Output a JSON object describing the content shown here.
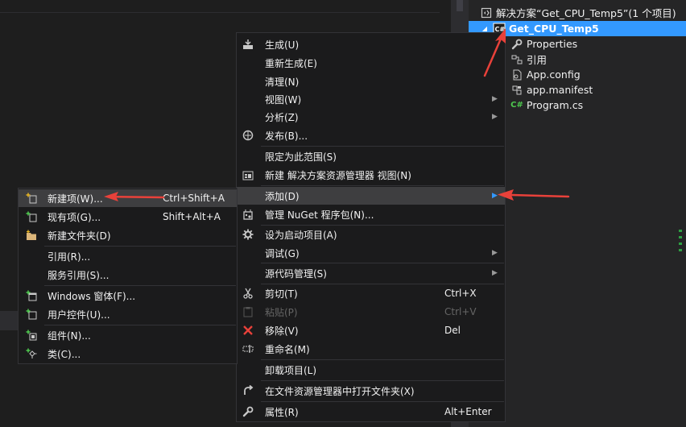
{
  "colors": {
    "menu_bg": "#1b1b1c",
    "menu_highlight": "#3e3e40",
    "selection": "#3399ff",
    "panel_bg": "#252526",
    "annotation_arrow": "#e8413a",
    "csharp_green": "#4ec94e"
  },
  "solution_explorer": {
    "solution": {
      "label": "解决方案“Get_CPU_Temp5”(1 个项目)",
      "icon": "solution-icon"
    },
    "project": {
      "label": "Get_CPU_Temp5",
      "icon": "csharp-project-icon",
      "selected": true
    },
    "items": [
      {
        "label": "Properties",
        "icon": "wrench-icon"
      },
      {
        "label": "引用",
        "icon": "references-icon"
      },
      {
        "label": "App.config",
        "icon": "config-file-icon"
      },
      {
        "label": "app.manifest",
        "icon": "manifest-file-icon"
      },
      {
        "label": "Program.cs",
        "icon": "csharp-file-icon"
      }
    ]
  },
  "context_menu": {
    "items": [
      {
        "label": "生成(U)",
        "icon": "build-icon"
      },
      {
        "label": "重新生成(E)"
      },
      {
        "label": "清理(N)"
      },
      {
        "label": "视图(W)",
        "submenu": true
      },
      {
        "label": "分析(Z)",
        "submenu": true
      },
      {
        "label": "发布(B)...",
        "icon": "publish-icon"
      },
      {
        "label": "限定为此范围(S)"
      },
      {
        "label": "新建 解决方案资源管理器 视图(N)",
        "icon": "new-view-icon"
      },
      {
        "label": "添加(D)",
        "submenu": true,
        "highlighted": true
      },
      {
        "label": "管理 NuGet 程序包(N)...",
        "icon": "nuget-icon"
      },
      {
        "label": "设为启动项目(A)",
        "icon": "gear-icon"
      },
      {
        "label": "调试(G)",
        "submenu": true
      },
      {
        "label": "源代码管理(S)",
        "submenu": true
      },
      {
        "label": "剪切(T)",
        "icon": "scissors-icon",
        "shortcut": "Ctrl+X"
      },
      {
        "label": "粘贴(P)",
        "icon": "paste-icon",
        "shortcut": "Ctrl+V",
        "disabled": true
      },
      {
        "label": "移除(V)",
        "icon": "remove-icon",
        "shortcut": "Del"
      },
      {
        "label": "重命名(M)",
        "icon": "rename-icon"
      },
      {
        "label": "卸载项目(L)"
      },
      {
        "label": "在文件资源管理器中打开文件夹(X)",
        "icon": "open-folder-arrow-icon"
      },
      {
        "label": "属性(R)",
        "icon": "wrench-icon",
        "shortcut": "Alt+Enter"
      }
    ]
  },
  "add_submenu": {
    "items": [
      {
        "label": "新建项(W)...",
        "icon": "new-item-icon",
        "shortcut": "Ctrl+Shift+A",
        "highlighted": true
      },
      {
        "label": "现有项(G)...",
        "icon": "existing-item-icon",
        "shortcut": "Shift+Alt+A"
      },
      {
        "label": "新建文件夹(D)",
        "icon": "new-folder-icon"
      },
      {
        "label": "引用(R)..."
      },
      {
        "label": "服务引用(S)..."
      },
      {
        "label": "Windows 窗体(F)...",
        "icon": "windows-form-icon"
      },
      {
        "label": "用户控件(U)...",
        "icon": "user-control-icon"
      },
      {
        "label": "组件(N)...",
        "icon": "component-icon"
      },
      {
        "label": "类(C)...",
        "icon": "class-icon"
      }
    ]
  }
}
